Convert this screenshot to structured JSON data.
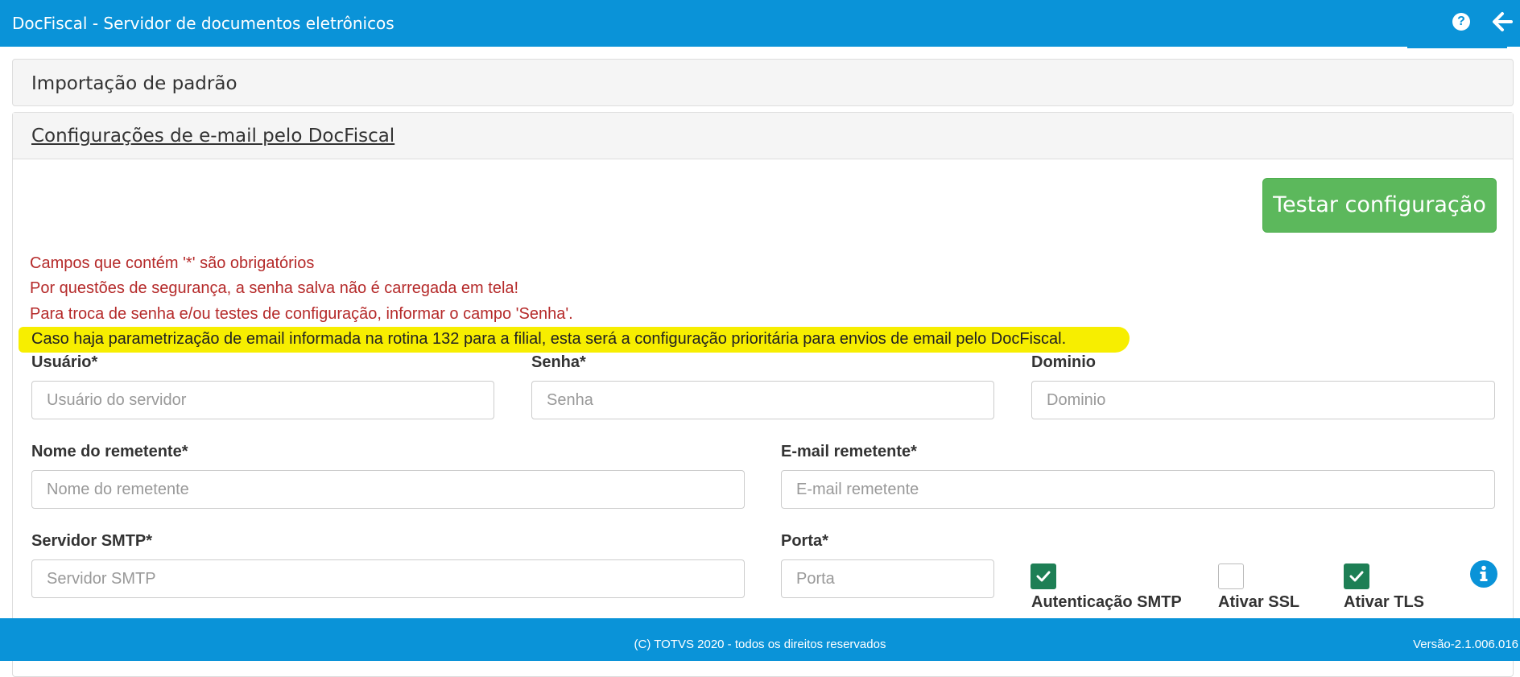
{
  "header": {
    "title": "DocFiscal - Servidor de documentos eletrônicos",
    "help_icon": "question-circle-icon",
    "back_icon": "arrow-left-icon"
  },
  "panels": {
    "import_title": "Importação de padrão",
    "email_title": "Configurações de e-mail pelo DocFiscal"
  },
  "actions": {
    "test_label": "Testar configuração"
  },
  "messages": {
    "required": "Campos que contém '*' são obrigatórios",
    "security": "Por questões de segurança, a senha salva não é carregada em tela!",
    "change": "Para troca de senha e/ou testes de configuração, informar o campo 'Senha'.",
    "priority": "Caso haja parametrização de email informada na rotina 132 para a filial, esta será a configuração prioritária para envios de email pelo DocFiscal."
  },
  "form": {
    "usuario": {
      "label": "Usuário*",
      "placeholder": "Usuário do servidor",
      "value": ""
    },
    "senha": {
      "label": "Senha*",
      "placeholder": "Senha",
      "value": ""
    },
    "dominio": {
      "label": "Dominio",
      "placeholder": "Dominio",
      "value": ""
    },
    "nome_remetente": {
      "label": "Nome do remetente*",
      "placeholder": "Nome do remetente",
      "value": ""
    },
    "email_remetente": {
      "label": "E-mail remetente*",
      "placeholder": "E-mail remetente",
      "value": ""
    },
    "servidor_smtp": {
      "label": "Servidor SMTP*",
      "placeholder": "Servidor SMTP",
      "value": ""
    },
    "porta": {
      "label": "Porta*",
      "placeholder": "Porta",
      "value": ""
    },
    "checkboxes": [
      {
        "label": "Autenticação SMTP",
        "checked": true
      },
      {
        "label": "Ativar SSL",
        "checked": false
      },
      {
        "label": "Ativar TLS",
        "checked": true
      }
    ],
    "info_icon": "info-circle-icon"
  },
  "footer": {
    "copyright": "(C) TOTVS 2020 - todos os direitos reservados",
    "version": "Versão-2.1.006.016"
  },
  "colors": {
    "primary": "#0a93d8",
    "success": "#5cb85c",
    "error_text": "#b52a2a",
    "highlight": "#f7ee00",
    "checkbox_on": "#1e7f55"
  }
}
